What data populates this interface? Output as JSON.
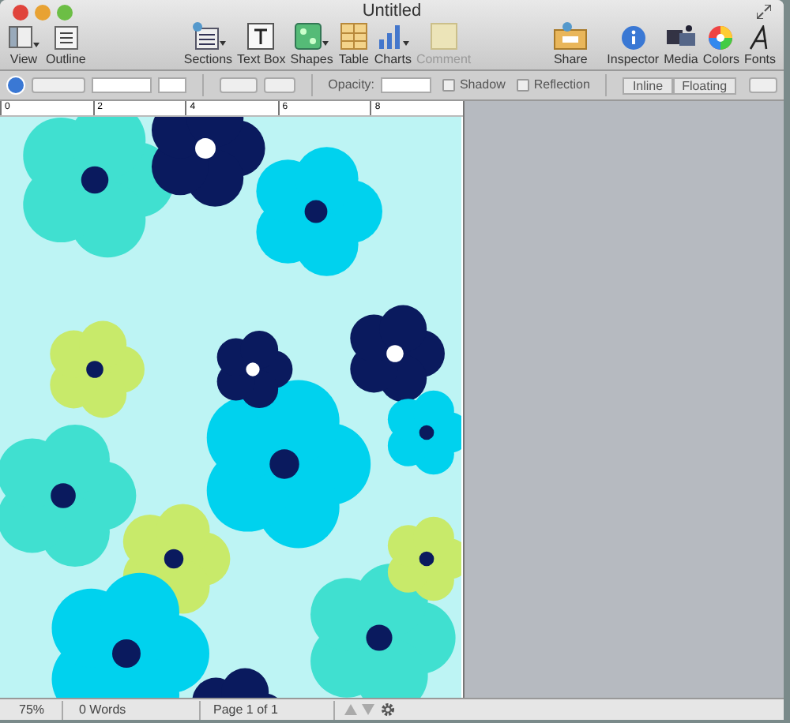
{
  "window": {
    "title": "Untitled"
  },
  "toolbar": {
    "left": [
      {
        "label": "View",
        "kind": "view",
        "disabled": false
      },
      {
        "label": "Outline",
        "kind": "outline",
        "disabled": false
      }
    ],
    "middle": [
      {
        "label": "Sections",
        "kind": "sections",
        "disabled": false
      },
      {
        "label": "Text Box",
        "kind": "textbox",
        "disabled": false
      },
      {
        "label": "Shapes",
        "kind": "shapes",
        "disabled": false
      },
      {
        "label": "Table",
        "kind": "table",
        "disabled": false
      },
      {
        "label": "Charts",
        "kind": "charts",
        "disabled": false
      },
      {
        "label": "Comment",
        "kind": "comment",
        "disabled": true
      }
    ],
    "share": {
      "label": "Share",
      "kind": "share",
      "disabled": false
    },
    "right": [
      {
        "label": "Inspector",
        "kind": "inspector",
        "disabled": false
      },
      {
        "label": "Media",
        "kind": "media",
        "disabled": false
      },
      {
        "label": "Colors",
        "kind": "colors",
        "disabled": false
      },
      {
        "label": "Fonts",
        "kind": "fonts",
        "disabled": false
      }
    ]
  },
  "format_bar": {
    "opacity_label": "Opacity:",
    "checkboxes": [
      {
        "label": "Shadow",
        "checked": false
      },
      {
        "label": "Reflection",
        "checked": false
      }
    ],
    "wrap": [
      {
        "label": "Inline",
        "selected": false
      },
      {
        "label": "Floating",
        "selected": false
      }
    ]
  },
  "ruler": {
    "marks": [
      "0",
      "2",
      "4",
      "6",
      "8"
    ]
  },
  "status_bar": {
    "zoom": "75%",
    "words": "0 Words",
    "page": "Page 1 of 1"
  }
}
